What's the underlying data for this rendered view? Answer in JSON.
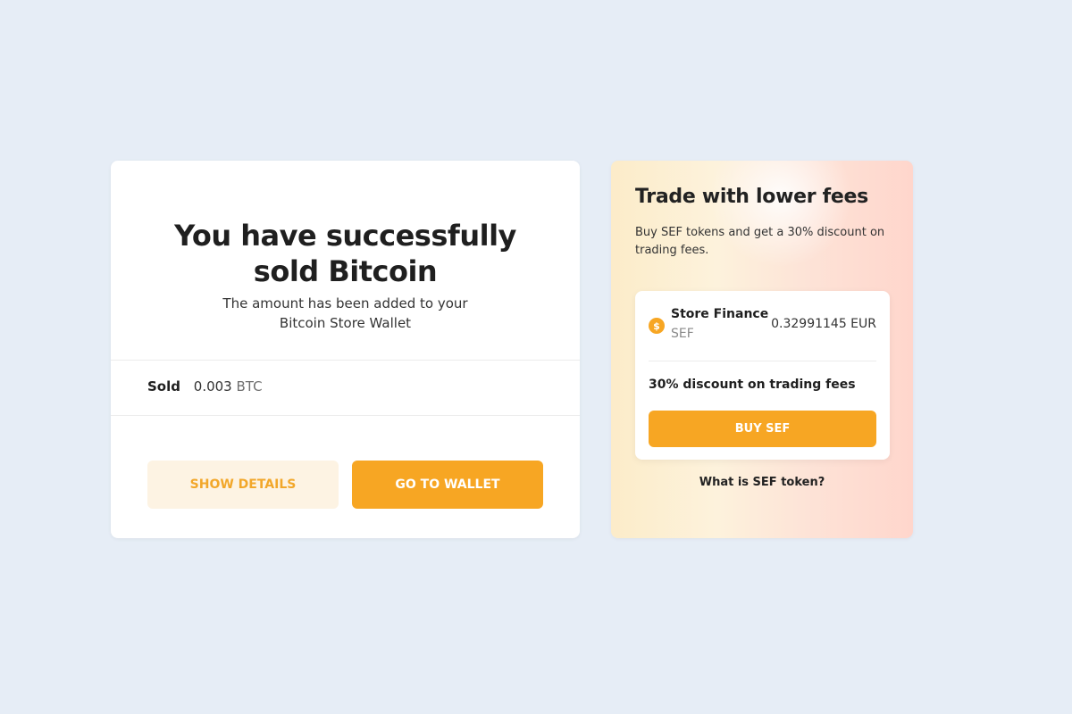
{
  "success": {
    "title_line1": "You have successfully",
    "title_line2": "sold Bitcoin",
    "subtitle_line1": "The amount has been added to your",
    "subtitle_line2": "Bitcoin Store Wallet",
    "sold_label": "Sold",
    "sold_amount": "0.003",
    "sold_unit": "BTC",
    "show_details_label": "SHOW DETAILS",
    "go_to_wallet_label": "GO TO WALLET"
  },
  "promo": {
    "title": "Trade with lower fees",
    "description": "Buy SEF tokens and get a 30% discount on trading fees.",
    "token": {
      "icon": "coin-icon",
      "icon_glyph": "$",
      "name": "Store Finance",
      "symbol": "SEF",
      "price": "0.32991145 EUR"
    },
    "discount_text": "30% discount on trading fees",
    "buy_label": "BUY SEF",
    "link_label": "What is SEF token?"
  },
  "colors": {
    "background": "#e6edf6",
    "accent": "#f7a623",
    "accent_light": "#fdf3e3"
  }
}
